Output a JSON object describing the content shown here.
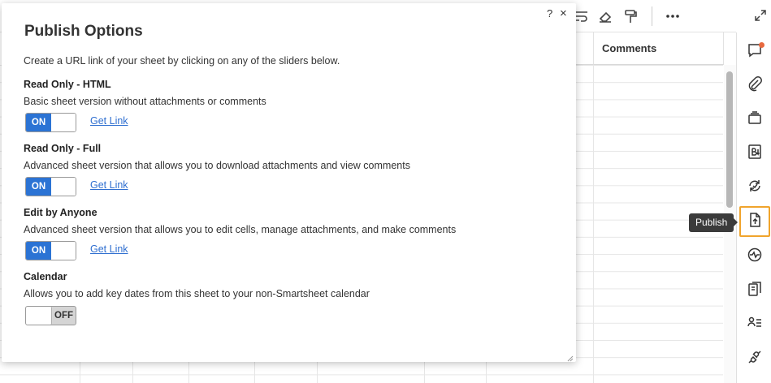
{
  "sheet": {
    "column_header": "Comments"
  },
  "rail": {
    "tooltip": "Publish",
    "items": [
      {
        "icon": "comment-icon"
      },
      {
        "icon": "attachment-icon"
      },
      {
        "icon": "proofing-icon"
      },
      {
        "icon": "summary-icon"
      },
      {
        "icon": "activity-log-icon"
      },
      {
        "icon": "publish-icon"
      },
      {
        "icon": "activity-icon"
      },
      {
        "icon": "forms-icon"
      },
      {
        "icon": "people-icon"
      },
      {
        "icon": "connectors-icon"
      }
    ]
  },
  "modal": {
    "title": "Publish Options",
    "description": "Create a URL link of your sheet by clicking on any of the sliders below.",
    "help": "?",
    "close": "×",
    "sections": [
      {
        "title": "Read Only - HTML",
        "description": "Basic sheet version without attachments or comments",
        "state": "ON",
        "link": "Get Link"
      },
      {
        "title": "Read Only - Full",
        "description": "Advanced sheet version that allows you to download attachments and view comments",
        "state": "ON",
        "link": "Get Link"
      },
      {
        "title": "Edit by Anyone",
        "description": "Advanced sheet version that allows you to edit cells, manage attachments, and make comments",
        "state": "ON",
        "link": "Get Link"
      },
      {
        "title": "Calendar",
        "description": "Allows you to add key dates from this sheet to your non-Smartsheet calendar",
        "state": "OFF"
      }
    ]
  },
  "colors": {
    "toggle_on": "#2b73d4",
    "link": "#2f6fd0",
    "active_rail_border": "#f0a42c",
    "notification": "#e8693f"
  }
}
